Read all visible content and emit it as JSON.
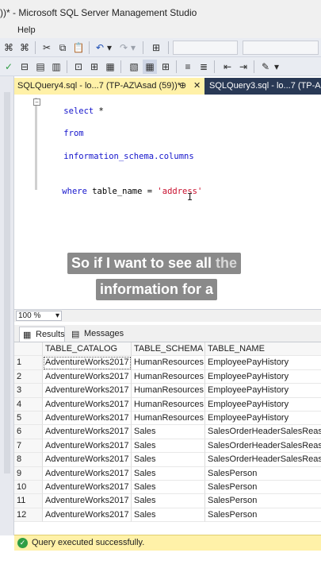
{
  "window": {
    "title": "))* - Microsoft SQL Server Management Studio"
  },
  "menubar": {
    "help": "Help"
  },
  "tabs": {
    "active": "SQLQuery4.sql - lo...7 (TP-AZ\\Asad (59))*",
    "active_pin": "⊕",
    "active_close": "✕",
    "inactive": "SQLQuery3.sql - lo...7 (TP-AZ"
  },
  "editor": {
    "collapse": "−",
    "line1_kw": "select",
    "line1_rest": " *",
    "line2_kw": "from",
    "line3_plain": "information_schema.columns",
    "line4_kw": "where",
    "line4_mid": " table_name = ",
    "line4_str": "'address'",
    "cursor": "I"
  },
  "captions": {
    "line1_main": "So if I want to see all ",
    "line1_faded": "the",
    "line2": "information for a"
  },
  "zoom": {
    "value": "100 %",
    "arrow": "▾"
  },
  "results_tabs": {
    "results": "Results",
    "messages": "Messages"
  },
  "grid": {
    "columns": [
      "",
      "TABLE_CATALOG",
      "TABLE_SCHEMA",
      "TABLE_NAME"
    ],
    "rows": [
      [
        "1",
        "AdventureWorks2017",
        "HumanResources",
        "EmployeePayHistory"
      ],
      [
        "2",
        "AdventureWorks2017",
        "HumanResources",
        "EmployeePayHistory"
      ],
      [
        "3",
        "AdventureWorks2017",
        "HumanResources",
        "EmployeePayHistory"
      ],
      [
        "4",
        "AdventureWorks2017",
        "HumanResources",
        "EmployeePayHistory"
      ],
      [
        "5",
        "AdventureWorks2017",
        "HumanResources",
        "EmployeePayHistory"
      ],
      [
        "6",
        "AdventureWorks2017",
        "Sales",
        "SalesOrderHeaderSalesReason"
      ],
      [
        "7",
        "AdventureWorks2017",
        "Sales",
        "SalesOrderHeaderSalesReason"
      ],
      [
        "8",
        "AdventureWorks2017",
        "Sales",
        "SalesOrderHeaderSalesReason"
      ],
      [
        "9",
        "AdventureWorks2017",
        "Sales",
        "SalesPerson"
      ],
      [
        "10",
        "AdventureWorks2017",
        "Sales",
        "SalesPerson"
      ],
      [
        "11",
        "AdventureWorks2017",
        "Sales",
        "SalesPerson"
      ],
      [
        "12",
        "AdventureWorks2017",
        "Sales",
        "SalesPerson"
      ]
    ]
  },
  "status": {
    "message": "Query executed successfully.",
    "icon": "✓"
  },
  "toolbar_icons": {
    "xml": "⌘",
    "dax": "⌘",
    "cut": "✂",
    "copy": "⧉",
    "paste": "📋",
    "undo": "↶",
    "undo_drop": "▾",
    "redo": "↷",
    "redo_drop": "▾",
    "props": "⊞",
    "check": "✓",
    "t2_1": "⊟",
    "t2_2": "▤",
    "t2_3": "▥",
    "t2_4": "⊡",
    "t2_5": "⊞",
    "t2_6": "▦",
    "t2_7": "▧",
    "t2_8": "≡",
    "t2_9": "≣",
    "t2_10": "⇤",
    "t2_11": "⇥",
    "t2_12": "✎",
    "t2_13": "▾"
  }
}
